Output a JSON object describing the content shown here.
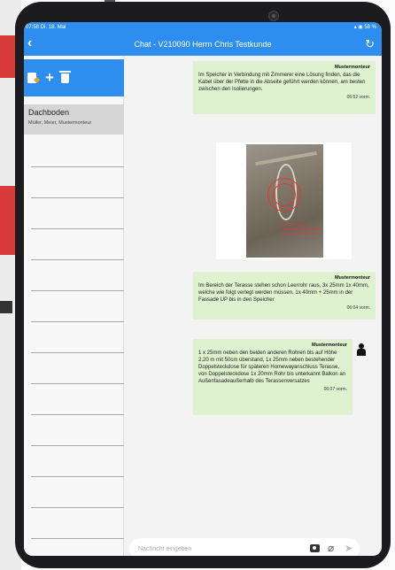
{
  "status": {
    "time": "07:58  Di. 18. Mai",
    "battery": "58 %"
  },
  "header": {
    "title": "Chat - V210090 Herrn Chris Testkunde",
    "back_icon": "chevron-left-icon",
    "refresh_icon": "refresh-icon"
  },
  "sidebar": {
    "toolbar": {
      "edit_icon": "edit-icon",
      "add_icon": "plus-icon",
      "delete_icon": "trash-icon"
    },
    "selected": {
      "name": "Dachboden",
      "members": "Müller, Meier, Mustermonteur"
    }
  },
  "messages": [
    {
      "author": "Mustermonteur",
      "text": "Im Speicher in Verbindung mit Zimmerer eine Lösung finden, das die Kabel über der Pfette in die Abseite geführt werden können, am besten zwischen den Isolierungen.",
      "time": "05:52 vorm."
    },
    {
      "author": "Mustermonteur",
      "text": "Im Bereich der Terasse stehen schon Leerrohr raus, 3x 25mm 1x 40mm, welche wie folgt verlegt werden müssen. 1x 40mm + 25mm in der Fassade UP bis in den Speicher",
      "time": "06:04 vorm."
    },
    {
      "author": "Mustermonteur",
      "text": "1 x 25mm neben den beiden anderen Rohren bis auf Höhe 2,20 m mit 50cm überstand, 1x 25mm neben bestehender Doppelsteckdose für späteren Homewayanschluss Terasse, von Doppelsteckdose 1x 20mm Rohr bis unterkannt Balkon an Außenfasadeaußerhalb des Terassenversatzes",
      "time": "06:07 vorm."
    }
  ],
  "image_message": {
    "annotation": "Das Rohr bitte in Verbindung mit Zimmerer unter der Pfette führen"
  },
  "input": {
    "placeholder": "Nachricht eingeben"
  },
  "input_icons": {
    "camera": "camera-icon",
    "attach": "paperclip-icon",
    "send": "send-icon"
  },
  "colors": {
    "accent": "#2e8ef0",
    "bubble": "#dff2cf"
  }
}
